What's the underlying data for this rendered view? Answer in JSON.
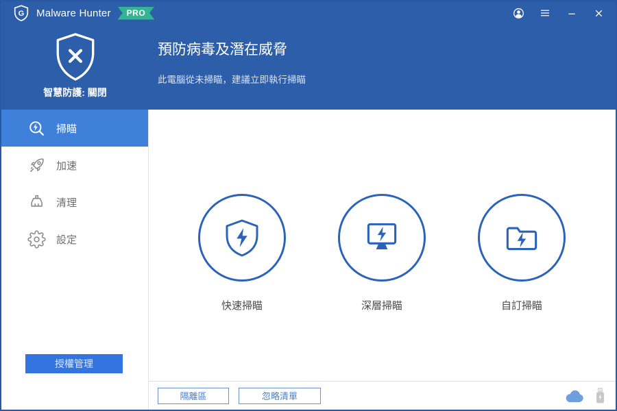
{
  "titlebar": {
    "app_name": "Malware Hunter",
    "badge": "PRO",
    "logo_letter": "G"
  },
  "header": {
    "status_icon": "shield-x-icon",
    "protection_status": "智慧防護: 關閉",
    "title": "預防病毒及潛在威脅",
    "subtitle": "此電腦從未掃瞄，建議立即執行掃瞄"
  },
  "sidebar": {
    "items": [
      {
        "label": "掃瞄",
        "icon": "scan-search-icon",
        "selected": true
      },
      {
        "label": "加速",
        "icon": "rocket-icon",
        "selected": false
      },
      {
        "label": "清理",
        "icon": "broom-icon",
        "selected": false
      },
      {
        "label": "設定",
        "icon": "gear-icon",
        "selected": false
      }
    ],
    "license_button": "授權管理"
  },
  "main": {
    "scan_options": [
      {
        "label": "快速掃瞄",
        "icon": "shield-bolt-icon"
      },
      {
        "label": "深層掃瞄",
        "icon": "monitor-bolt-icon"
      },
      {
        "label": "自訂掃瞄",
        "icon": "folder-bolt-icon"
      }
    ]
  },
  "footer": {
    "quarantine_button": "隔離區",
    "ignore_button": "忽略清單",
    "icons": [
      "cloud-icon",
      "usb-icon"
    ]
  },
  "colors": {
    "header_blue": "#2d5ea9",
    "selected_item_blue": "#3f80db",
    "license_button_blue": "#3374e0",
    "circle_icon_blue": "#2b63ba",
    "badge_green": "#35b493",
    "cloud_blue": "#6f9edd",
    "usb_gray": "#c7c7c7"
  }
}
